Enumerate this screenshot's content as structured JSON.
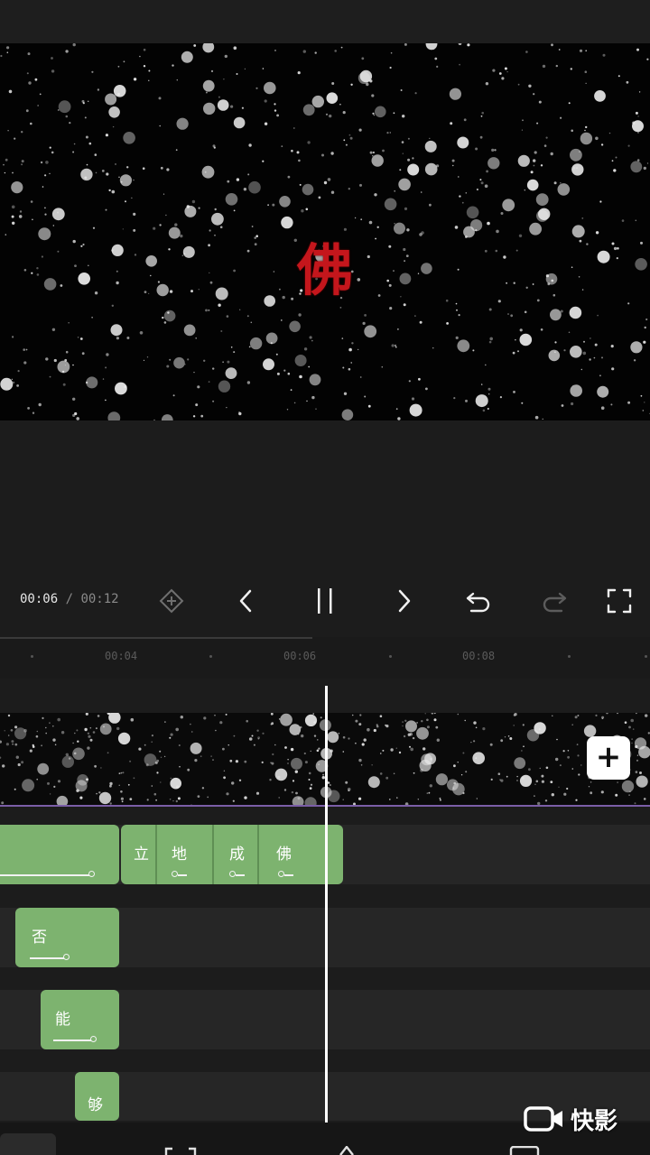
{
  "preview": {
    "caption_char": "佛"
  },
  "player": {
    "current_time": "00:06",
    "separator": " / ",
    "total_time": "00:12",
    "icons": [
      "keyframe-icon",
      "previous-frame-icon",
      "pause-icon",
      "next-frame-icon",
      "undo-icon",
      "redo-icon",
      "fullscreen-icon"
    ]
  },
  "ruler": {
    "ticks": [
      "00:04",
      "00:06",
      "00:08"
    ]
  },
  "timeline": {
    "add_clip_label": "+",
    "caption_lane_1": [
      {
        "text": ""
      },
      {
        "text": "立"
      },
      {
        "text": "地"
      },
      {
        "text": "成"
      },
      {
        "text": "佛"
      }
    ],
    "caption_lane_2": {
      "text": "否"
    },
    "caption_lane_3": {
      "text": "能"
    },
    "caption_lane_4": {
      "text": "够"
    }
  },
  "watermark": {
    "text": "快影"
  }
}
